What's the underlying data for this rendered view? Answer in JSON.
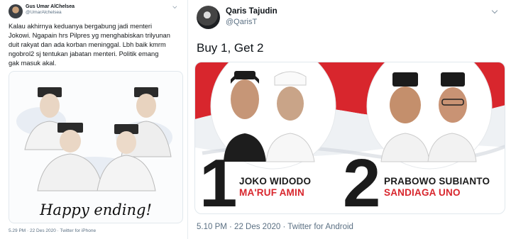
{
  "tweet_left": {
    "name": "Gus Umar AlChelsea",
    "handle": "@UmarAlchelsea",
    "text": "Kalau akhirnya keduanya bergabung jadi menteri\nJokowi. Ngapain hrs Pilpres yg menghabiskan trilyunan\nduit rakyat dan ada korban meninggal. Lbh baik kmrm\nngobrol2 sj tentukan jabatan menteri. Politik emang\ngak masuk akal.",
    "image_caption": "Happy ending!",
    "meta": "5.29 PM · 22 Des 2020 · Twitter for iPhone",
    "avatar_icon": "profile-avatar",
    "menu_icon": "chevron-down-icon"
  },
  "tweet_right": {
    "name": "Qaris Tajudin",
    "handle": "@QarisT",
    "text": "Buy 1, Get 2",
    "meta": "5.10 PM · 22 Des 2020 · Twitter for Android",
    "avatar_icon": "profile-avatar",
    "menu_icon": "chevron-down-icon",
    "poster": {
      "number_1": "1",
      "number_2": "2",
      "pair_1_line_1": "JOKO WIDODO",
      "pair_1_line_2": "MA'RUF AMIN",
      "pair_2_line_1": "PRABOWO SUBIANTO",
      "pair_2_line_2": "SANDIAGA UNO",
      "accent_color": "#d8262d"
    }
  }
}
